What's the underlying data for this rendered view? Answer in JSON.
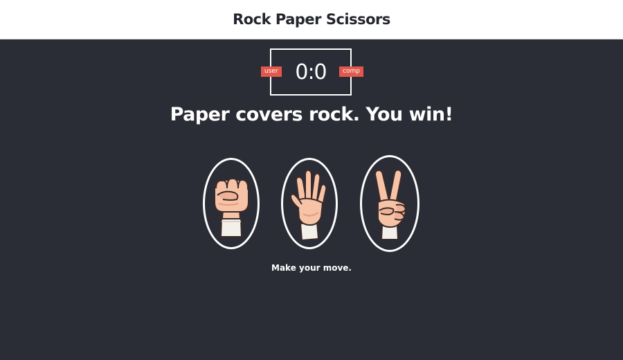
{
  "app": {
    "title": "Rock Paper Scissors"
  },
  "scoreboard": {
    "score": "0:0",
    "user_label": "user",
    "comp_label": "comp"
  },
  "result_message": "Paper covers rock. You win!",
  "choices": [
    {
      "id": "rock",
      "icon": "rock-fist-icon"
    },
    {
      "id": "paper",
      "icon": "paper-hand-icon"
    },
    {
      "id": "scissors",
      "icon": "scissors-hand-icon"
    }
  ],
  "prompt": "Make your move.",
  "colors": {
    "background": "#2b2d36",
    "header_bg": "#ffffff",
    "badge": "#e2584d",
    "skin": "#f6c3a6",
    "skin_shadow": "#e59a80",
    "outline": "#3a2a2a",
    "cuff": "#f3efe9"
  }
}
